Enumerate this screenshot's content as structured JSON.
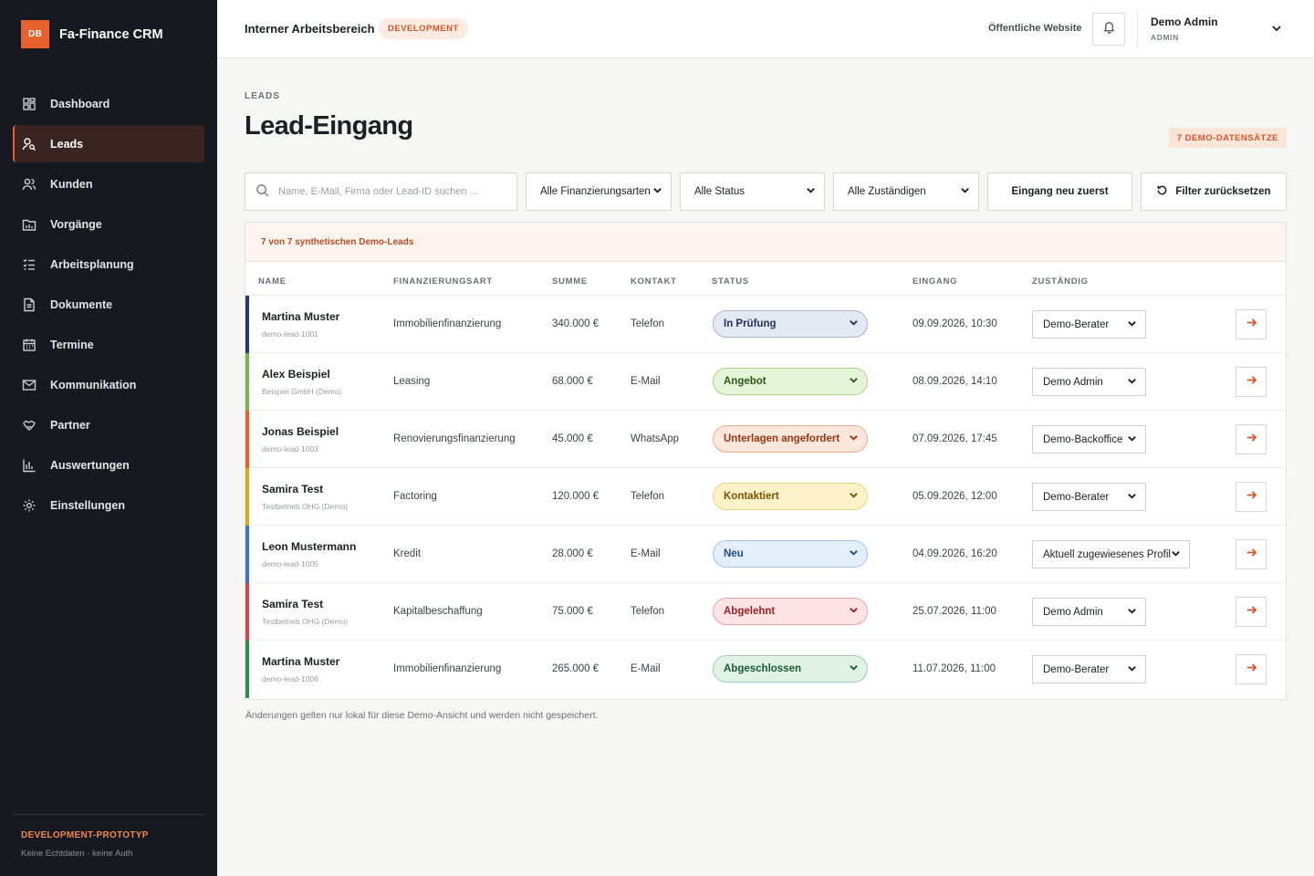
{
  "brand": {
    "logo": "DB",
    "name": "Fa-Finance CRM"
  },
  "nav": [
    {
      "label": "Dashboard",
      "icon": "dashboard-icon",
      "active": false
    },
    {
      "label": "Leads",
      "icon": "user-search-icon",
      "active": true
    },
    {
      "label": "Kunden",
      "icon": "users-icon",
      "active": false
    },
    {
      "label": "Vorgänge",
      "icon": "folder-chart-icon",
      "active": false
    },
    {
      "label": "Arbeitsplanung",
      "icon": "list-check-icon",
      "active": false
    },
    {
      "label": "Dokumente",
      "icon": "document-icon",
      "active": false
    },
    {
      "label": "Termine",
      "icon": "calendar-icon",
      "active": false
    },
    {
      "label": "Kommunikation",
      "icon": "mail-icon",
      "active": false
    },
    {
      "label": "Partner",
      "icon": "handshake-icon",
      "active": false
    },
    {
      "label": "Auswertungen",
      "icon": "bar-chart-icon",
      "active": false
    },
    {
      "label": "Einstellungen",
      "icon": "gear-icon",
      "active": false
    }
  ],
  "sidebar_footer": {
    "title": "DEVELOPMENT-PROTOTYP",
    "subtitle": "Keine Echtdaten · keine Auth"
  },
  "topbar": {
    "title": "Interner Arbeitsbereich",
    "env_badge": "DEVELOPMENT",
    "public_link": "Öffentliche Website",
    "user_name": "Demo Admin",
    "user_role": "ADMIN"
  },
  "page": {
    "eyebrow": "LEADS",
    "title": "Lead-Eingang",
    "count_badge": "7 DEMO-DATENSÄTZE"
  },
  "filters": {
    "search_placeholder": "Name, E-Mail, Firma oder Lead-ID suchen ...",
    "financing": "Alle Finanzierungsarten",
    "status": "Alle Status",
    "assignee": "Alle Zuständigen",
    "sort": "Eingang neu zuerst",
    "reset": "Filter zurücksetzen"
  },
  "table": {
    "banner": "7 von 7 synthetischen Demo-Leads",
    "headers": {
      "name": "NAME",
      "type": "FINANZIERUNGSART",
      "sum": "SUMME",
      "contact": "KONTAKT",
      "status": "STATUS",
      "received": "EINGANG",
      "assignee": "ZUSTÄNDIG"
    },
    "rows": [
      {
        "name": "Martina Muster",
        "sub": "demo-lead-1001",
        "type": "Immobilienfinanzierung",
        "sum": "340.000 €",
        "contact": "Telefon",
        "status": "In Prüfung",
        "status_colors": {
          "bar": "#2b3a63",
          "bg": "#e3e9f3",
          "border": "#a9b6cf",
          "text": "#1f2f57"
        },
        "received": "09.09.2026, 10:30",
        "assignee": "Demo-Berater"
      },
      {
        "name": "Alex Beispiel",
        "sub": "Beispiel GmbH (Demo)",
        "type": "Leasing",
        "sum": "68.000 €",
        "contact": "E-Mail",
        "status": "Angebot",
        "status_colors": {
          "bar": "#7fb24a",
          "bg": "#e6f4d8",
          "border": "#a9d287",
          "text": "#2b5a14"
        },
        "received": "08.09.2026, 14:10",
        "assignee": "Demo Admin"
      },
      {
        "name": "Jonas Beispiel",
        "sub": "demo-lead-1003",
        "type": "Renovierungsfinanzierung",
        "sum": "45.000 €",
        "contact": "WhatsApp",
        "status": "Unterlagen angefordert",
        "status_colors": {
          "bar": "#e8602c",
          "bg": "#fde6dc",
          "border": "#f0a98a",
          "text": "#9a3612"
        },
        "received": "07.09.2026, 17:45",
        "assignee": "Demo-Backoffice"
      },
      {
        "name": "Samira Test",
        "sub": "Testbetrieb OHG (Demo)",
        "type": "Factoring",
        "sum": "120.000 €",
        "contact": "Telefon",
        "status": "Kontaktiert",
        "status_colors": {
          "bar": "#d9a91b",
          "bg": "#fdf1c9",
          "border": "#edd27c",
          "text": "#7a5300"
        },
        "received": "05.09.2026, 12:00",
        "assignee": "Demo-Berater"
      },
      {
        "name": "Leon Mustermann",
        "sub": "demo-lead-1005",
        "type": "Kredit",
        "sum": "28.000 €",
        "contact": "E-Mail",
        "status": "Neu",
        "status_colors": {
          "bar": "#3b74c4",
          "bg": "#e4eefb",
          "border": "#a8c3e8",
          "text": "#1d4b8a"
        },
        "received": "04.09.2026, 16:20",
        "assignee": "Aktuell zugewiesenes Profil"
      },
      {
        "name": "Samira Test",
        "sub": "Testbetrieb OHG (Demo)",
        "type": "Kapitalbeschaffung",
        "sum": "75.000 €",
        "contact": "Telefon",
        "status": "Abgelehnt",
        "status_colors": {
          "bar": "#d04848",
          "bg": "#fde3e3",
          "border": "#eda4a4",
          "text": "#9a1f1f"
        },
        "received": "25.07.2026, 11:00",
        "assignee": "Demo Admin"
      },
      {
        "name": "Martina Muster",
        "sub": "demo-lead-1006",
        "type": "Immobilienfinanzierung",
        "sum": "265.000 €",
        "contact": "E-Mail",
        "status": "Abgeschlossen",
        "status_colors": {
          "bar": "#2f8a4e",
          "bg": "#dff2e4",
          "border": "#9ccfac",
          "text": "#1c5a31"
        },
        "received": "11.07.2026, 11:00",
        "assignee": "Demo-Berater"
      }
    ]
  },
  "footnote": "Änderungen gelten nur lokal für diese Demo-Ansicht und werden nicht gespeichert."
}
